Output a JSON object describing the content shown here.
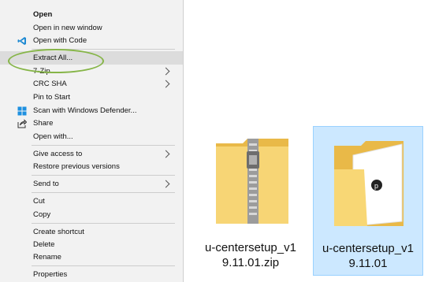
{
  "menu": {
    "items": [
      {
        "label": "Open",
        "bold": true
      },
      {
        "label": "Open in new window"
      },
      {
        "label": "Open with Code",
        "icon": "vscode-icon"
      },
      {
        "label": "Extract All...",
        "highlighted": true
      },
      {
        "label": "7-Zip",
        "submenu": true
      },
      {
        "label": "CRC SHA",
        "submenu": true
      },
      {
        "label": "Pin to Start"
      },
      {
        "label": "Scan with Windows Defender...",
        "icon": "defender-icon"
      },
      {
        "label": "Share",
        "icon": "share-icon"
      },
      {
        "label": "Open with..."
      },
      {
        "label": "Give access to",
        "submenu": true
      },
      {
        "label": "Restore previous versions"
      },
      {
        "label": "Send to",
        "submenu": true
      },
      {
        "label": "Cut"
      },
      {
        "label": "Copy"
      },
      {
        "label": "Create shortcut"
      },
      {
        "label": "Delete"
      },
      {
        "label": "Rename"
      },
      {
        "label": "Properties"
      }
    ]
  },
  "files": [
    {
      "name_line1": "u-centersetup_v1",
      "name_line2": "9.11.01.zip",
      "type": "zip-folder-icon",
      "selected": false
    },
    {
      "name_line1": "u-centersetup_v1",
      "name_line2": "9.11.01",
      "type": "folder-icon",
      "selected": true
    }
  ],
  "colors": {
    "highlight_ring": "#86b548",
    "selection": "#cce8ff",
    "folder": "#f8d775"
  }
}
